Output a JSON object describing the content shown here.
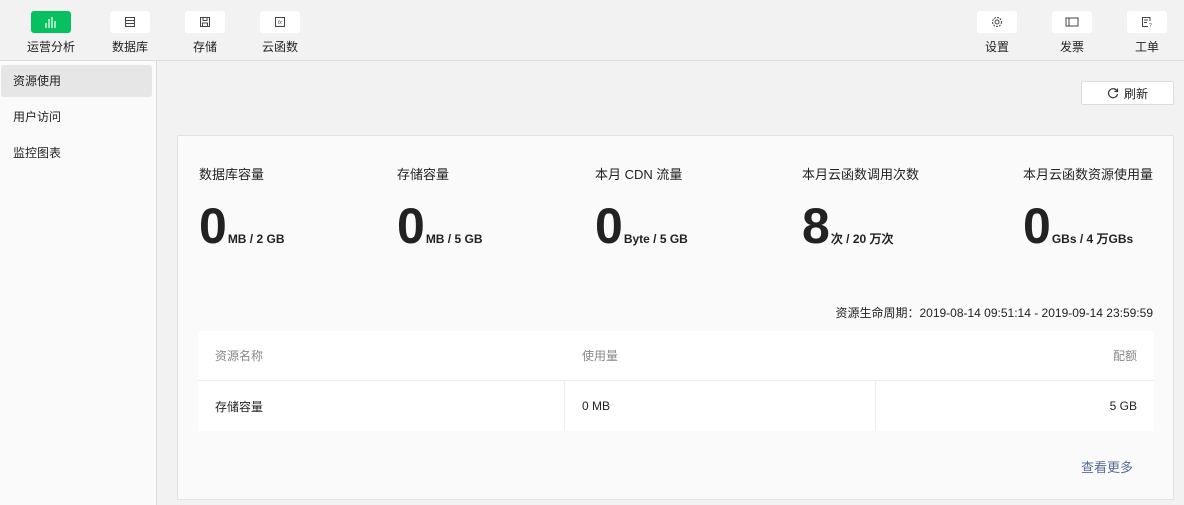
{
  "toolbar": {
    "left": [
      {
        "label": "运营分析",
        "icon": "bar-chart-icon",
        "active": true
      },
      {
        "label": "数据库",
        "icon": "database-icon"
      },
      {
        "label": "存储",
        "icon": "save-icon"
      },
      {
        "label": "云函数",
        "icon": "function-icon"
      }
    ],
    "right": [
      {
        "label": "设置",
        "icon": "gear-icon"
      },
      {
        "label": "发票",
        "icon": "ticket-icon"
      },
      {
        "label": "工单",
        "icon": "ticket-question-icon"
      }
    ]
  },
  "sidebar": {
    "items": [
      {
        "label": "资源使用"
      },
      {
        "label": "用户访问"
      },
      {
        "label": "监控图表"
      }
    ]
  },
  "refresh_label": "刷新",
  "stats": [
    {
      "title": "数据库容量",
      "value": "0",
      "unit": "MB / 2 GB"
    },
    {
      "title": "存储容量",
      "value": "0",
      "unit": "MB / 5 GB"
    },
    {
      "title": "本月 CDN 流量",
      "value": "0",
      "unit": "Byte / 5 GB"
    },
    {
      "title": "本月云函数调用次数",
      "value": "8",
      "unit": "次 / 20 万次"
    },
    {
      "title": "本月云函数资源使用量",
      "value": "0",
      "unit": "GBs / 4 万GBs"
    }
  ],
  "period": "资源生命周期：2019-08-14 09:51:14 - 2019-09-14 23:59:59",
  "table": {
    "headers": [
      "资源名称",
      "使用量",
      "配额"
    ],
    "rows": [
      [
        "存储容量",
        "0 MB",
        "5 GB"
      ]
    ]
  },
  "more_label": "查看更多",
  "accent": "#07c160"
}
